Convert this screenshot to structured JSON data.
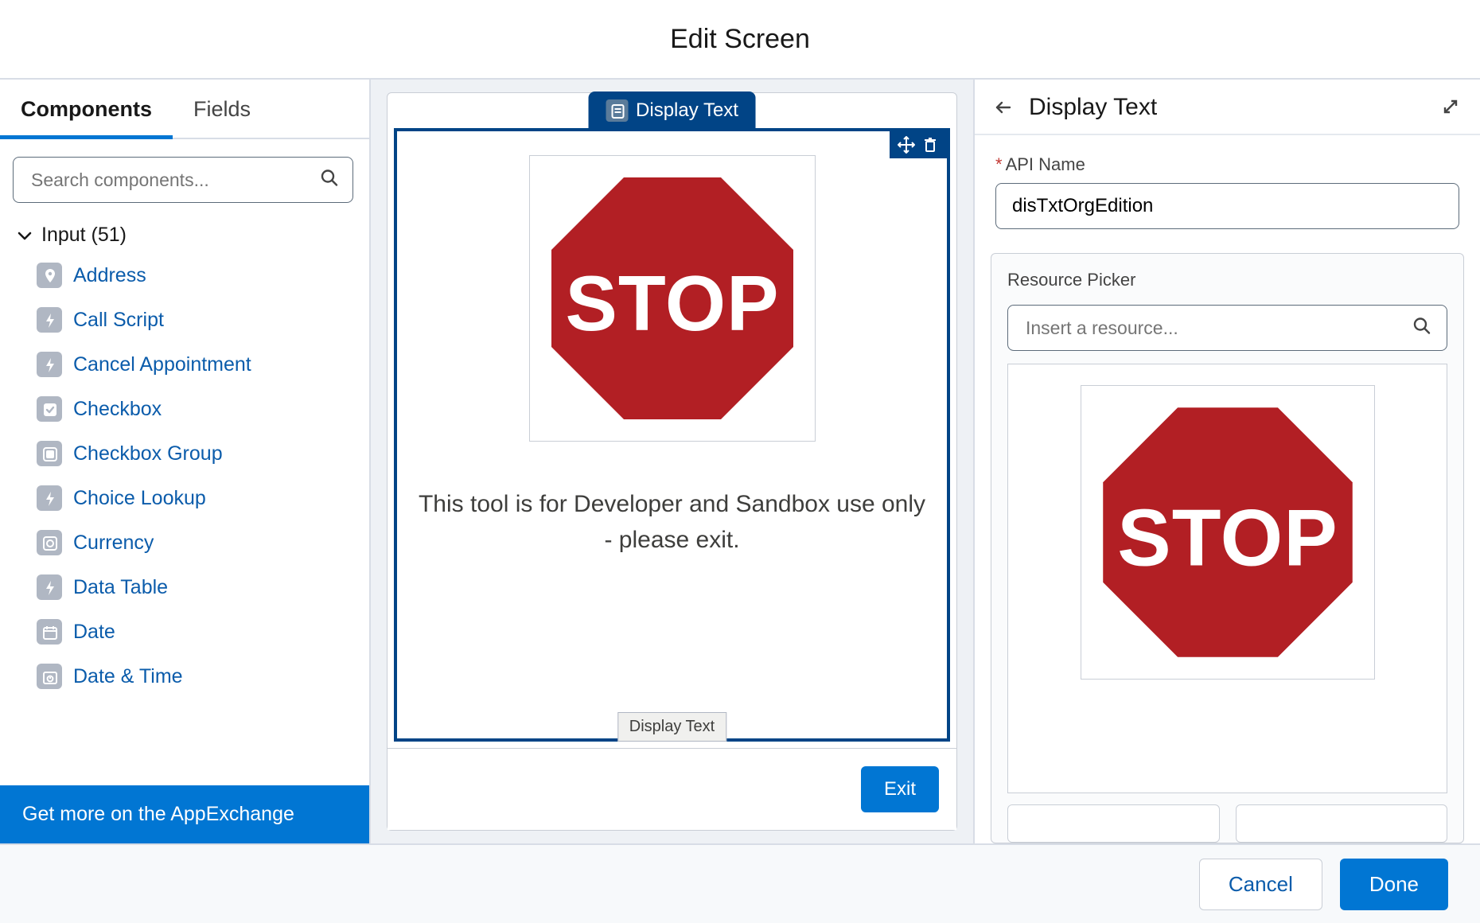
{
  "title": "Edit Screen",
  "left": {
    "tabs": {
      "components": "Components",
      "fields": "Fields"
    },
    "search_placeholder": "Search components...",
    "category_label": "Input (51)",
    "items": [
      {
        "label": "Address",
        "icon": "pin"
      },
      {
        "label": "Call Script",
        "icon": "bolt"
      },
      {
        "label": "Cancel Appointment",
        "icon": "bolt"
      },
      {
        "label": "Checkbox",
        "icon": "check"
      },
      {
        "label": "Checkbox Group",
        "icon": "checkgroup"
      },
      {
        "label": "Choice Lookup",
        "icon": "bolt"
      },
      {
        "label": "Currency",
        "icon": "currency"
      },
      {
        "label": "Data Table",
        "icon": "bolt"
      },
      {
        "label": "Date",
        "icon": "date"
      },
      {
        "label": "Date & Time",
        "icon": "datetime"
      }
    ],
    "appexchange": "Get more on the AppExchange"
  },
  "canvas": {
    "pill_label": "Display Text",
    "message": "This tool is for Developer and Sandbox use only - please exit.",
    "hover_tag": "Display Text",
    "stop_text": "STOP",
    "exit_button": "Exit"
  },
  "right": {
    "title": "Display Text",
    "api_name_label": "API Name",
    "api_name_value": "disTxtOrgEdition",
    "resource_label": "Resource Picker",
    "resource_placeholder": "Insert a resource...",
    "stop_text": "STOP"
  },
  "footer": {
    "cancel": "Cancel",
    "done": "Done"
  }
}
